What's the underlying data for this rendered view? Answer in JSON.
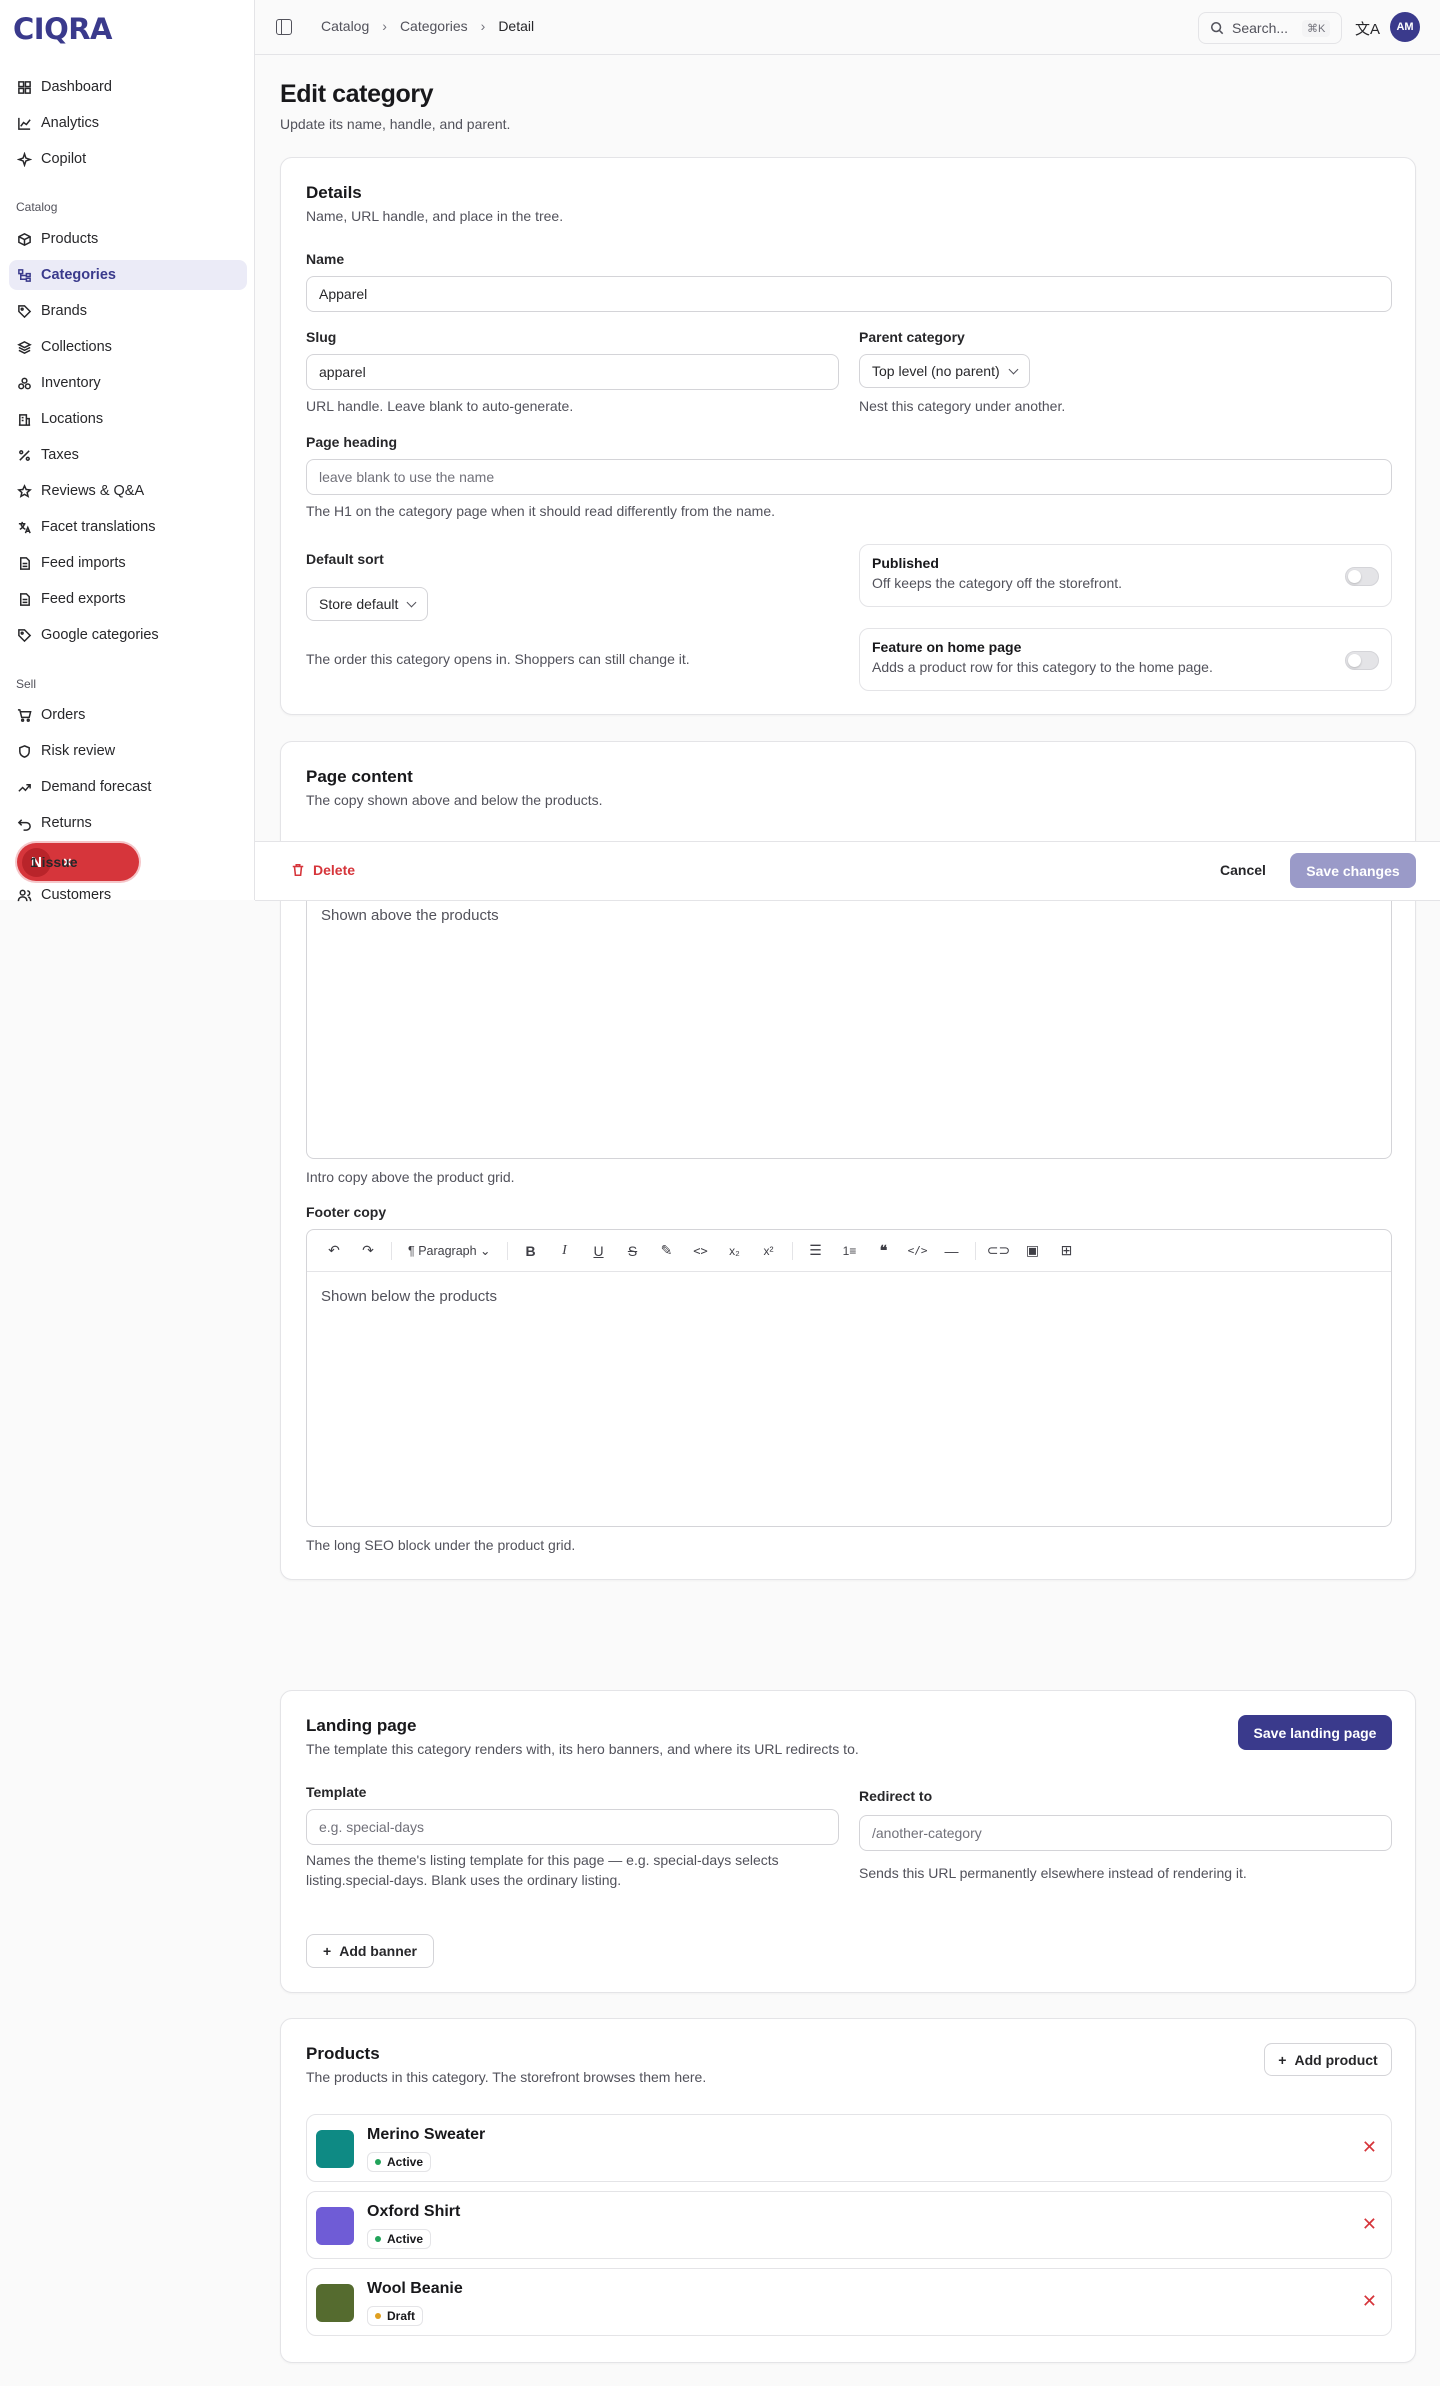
{
  "brand": {
    "logo": "CIQRA",
    "accent": "#3a3a8c",
    "danger": "#d6353b"
  },
  "sidebar": {
    "main": [
      {
        "label": "Dashboard",
        "icon": "dashboard-icon"
      },
      {
        "label": "Analytics",
        "icon": "chart-icon"
      },
      {
        "label": "Copilot",
        "icon": "sparkle-icon"
      }
    ],
    "catalog_title": "Catalog",
    "catalog": [
      {
        "label": "Products",
        "icon": "box-icon"
      },
      {
        "label": "Categories",
        "icon": "tree-icon"
      },
      {
        "label": "Brands",
        "icon": "tag-icon"
      },
      {
        "label": "Collections",
        "icon": "layers-icon"
      },
      {
        "label": "Inventory",
        "icon": "boxes-icon"
      },
      {
        "label": "Locations",
        "icon": "building-icon"
      },
      {
        "label": "Taxes",
        "icon": "percent-icon"
      },
      {
        "label": "Reviews & Q&A",
        "icon": "star-icon"
      },
      {
        "label": "Facet translations",
        "icon": "translate-icon"
      },
      {
        "label": "Feed imports",
        "icon": "file-in-icon"
      },
      {
        "label": "Feed exports",
        "icon": "file-out-icon"
      },
      {
        "label": "Google categories",
        "icon": "tag-icon"
      }
    ],
    "sell_title": "Sell",
    "sell": [
      {
        "label": "Orders",
        "icon": "cart-icon"
      },
      {
        "label": "Risk review",
        "icon": "shield-icon"
      },
      {
        "label": "Demand forecast",
        "icon": "trend-icon"
      },
      {
        "label": "Returns",
        "icon": "return-icon"
      },
      {
        "label": "Customers",
        "icon": "users-icon"
      }
    ],
    "issue_badge": {
      "letter": "N",
      "label": "1 issue"
    }
  },
  "topbar": {
    "crumbs": [
      "Catalog",
      "Categories",
      "Detail"
    ],
    "search_placeholder": "Search...",
    "search_kbd": "⌘K",
    "avatar": "AM"
  },
  "page": {
    "title": "Edit category",
    "subtitle": "Update its name, handle, and parent."
  },
  "details": {
    "title": "Details",
    "subtitle": "Name, URL handle, and place in the tree.",
    "name_label": "Name",
    "name_value": "Apparel",
    "slug_label": "Slug",
    "slug_value": "apparel",
    "slug_help": "URL handle. Leave blank to auto-generate.",
    "parent_label": "Parent category",
    "parent_value": "Top level (no parent)",
    "parent_help": "Nest this category under another.",
    "heading_label": "Page heading",
    "heading_placeholder": "leave blank to use the name",
    "heading_help": "The H1 on the category page when it should read differently from the name.",
    "sort_label": "Default sort",
    "sort_value": "Store default",
    "sort_help": "The order this category opens in. Shoppers can still change it.",
    "published_title": "Published",
    "published_desc": "Off keeps the category off the storefront.",
    "feature_title": "Feature on home page",
    "feature_desc": "Adds a product row for this category to the home page."
  },
  "content": {
    "title": "Page content",
    "subtitle": "The copy shown above and below the products.",
    "intro_placeholder": "Shown above the products",
    "intro_help": "Intro copy above the product grid.",
    "footer_label": "Footer copy",
    "paragraph": "Paragraph",
    "footer_placeholder": "Shown below the products",
    "footer_help": "The long SEO block under the product grid."
  },
  "actions": {
    "delete": "Delete",
    "cancel": "Cancel",
    "save": "Save changes"
  },
  "landing": {
    "title": "Landing page",
    "subtitle": "The template this category renders with, its hero banners, and where its URL redirects to.",
    "save": "Save landing page",
    "template_label": "Template",
    "template_placeholder": "e.g. special-days",
    "template_help_1": "Names the theme's listing template for this page — e.g. special-days selects",
    "template_help_2": "listing.special-days. Blank uses the ordinary listing.",
    "redirect_label": "Redirect to",
    "redirect_placeholder": "/another-category",
    "redirect_help": "Sends this URL permanently elsewhere instead of rendering it.",
    "add_banner": "Add banner"
  },
  "products": {
    "title": "Products",
    "subtitle": "The products in this category. The storefront browses them here.",
    "add": "Add product",
    "items": [
      {
        "name": "Merino Sweater",
        "status": "Active",
        "color": "#0e8a84",
        "dot": "#22a35a"
      },
      {
        "name": "Oxford Shirt",
        "status": "Active",
        "color": "#6f5cd6",
        "dot": "#22a35a"
      },
      {
        "name": "Wool Beanie",
        "status": "Draft",
        "color": "#556b2f",
        "dot": "#e0a020"
      }
    ]
  }
}
